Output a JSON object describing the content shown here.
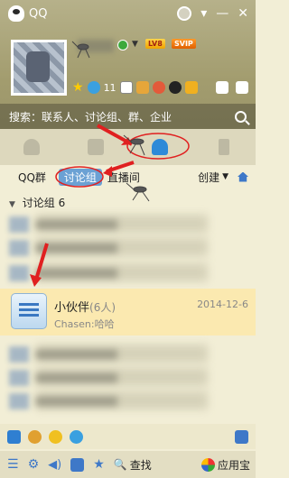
{
  "window": {
    "title": "QQ"
  },
  "profile": {
    "level_badge": "LV8",
    "vip_badge": "SVIP",
    "level_number": "11"
  },
  "search": {
    "placeholder": "搜索：联系人、讨论组、群、企业"
  },
  "sub_tabs": [
    {
      "label": "QQ群"
    },
    {
      "label": "讨论组"
    },
    {
      "label": "直播间"
    },
    {
      "label": "创建"
    }
  ],
  "group": {
    "title": "讨论组",
    "count": "6"
  },
  "selected_item": {
    "name": "小伙伴",
    "count": "(6人)",
    "date": "2014-12-6",
    "last_message": "Chasen:哈哈"
  },
  "bottom_bar": {
    "find_label": "查找",
    "app_label": "应用宝"
  },
  "colors": {
    "header_bg": "#a29c6e",
    "selected_row_bg": "#fbe9b0",
    "accent_blue": "#2e8ad8",
    "annotation_red": "#e02020"
  }
}
